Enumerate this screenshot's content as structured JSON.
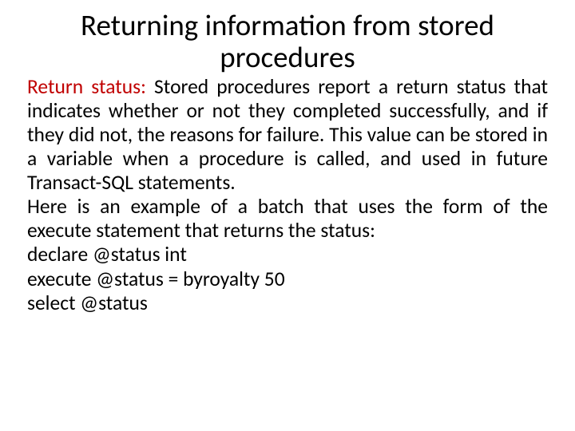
{
  "title": "Returning information from stored procedures",
  "body": {
    "label": "Return status:",
    "para1_rest": " Stored procedures report a return status that indicates whether or not they completed successfully, and if they did not, the reasons for failure. This value can be stored in a variable when a procedure is called, and used in future Transact-SQL statements.",
    "para2": "Here is an example of a batch that uses the form of the execute statement that returns the status:",
    "code1": "declare @status int",
    "code2": "execute @status = byroyalty 50",
    "code3": "select @status"
  }
}
